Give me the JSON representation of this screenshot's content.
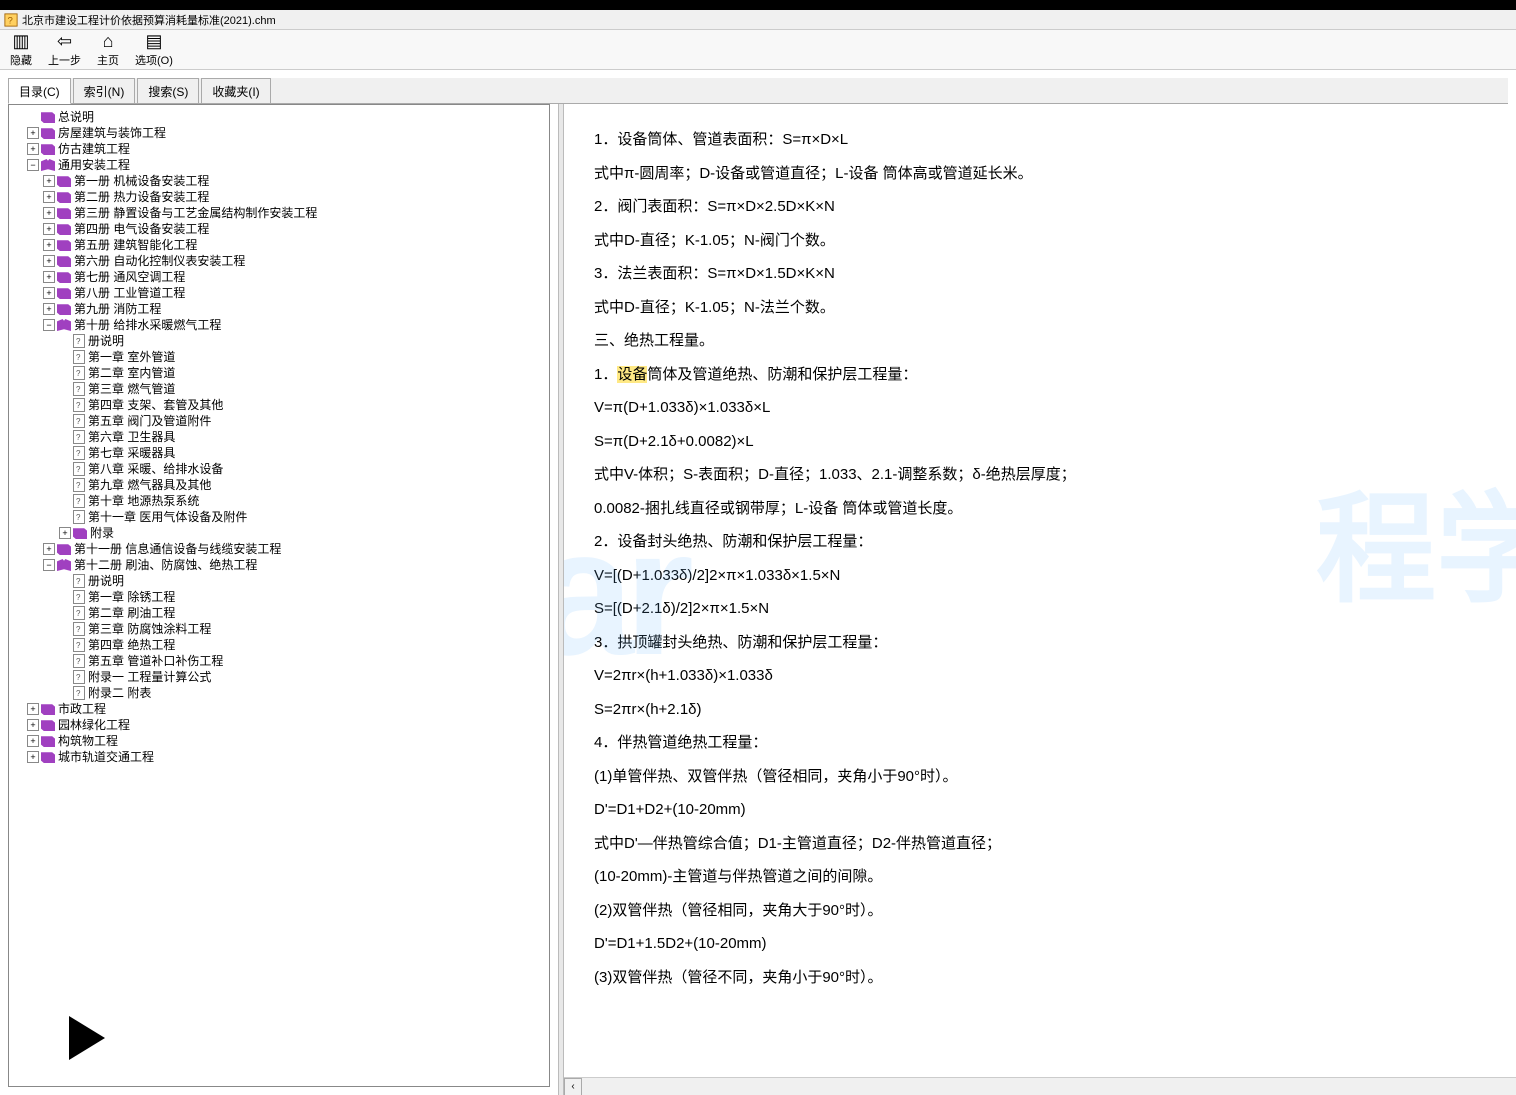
{
  "window": {
    "title": "北京市建设工程计价依据预算消耗量标准(2021).chm"
  },
  "toolbar": {
    "hide": "隐藏",
    "back": "上一步",
    "home": "主页",
    "options": "选项(O)"
  },
  "tabs": {
    "toc": "目录(C)",
    "index": "索引(N)",
    "search": "搜索(S)",
    "fav": "收藏夹(I)"
  },
  "tree": {
    "n0": "总说明",
    "n1": "房屋建筑与装饰工程",
    "n2": "仿古建筑工程",
    "n3": "通用安装工程",
    "n3_1": "第一册 机械设备安装工程",
    "n3_2": "第二册 热力设备安装工程",
    "n3_3": "第三册 静置设备与工艺金属结构制作安装工程",
    "n3_4": "第四册 电气设备安装工程",
    "n3_5": "第五册 建筑智能化工程",
    "n3_6": "第六册 自动化控制仪表安装工程",
    "n3_7": "第七册 通风空调工程",
    "n3_8": "第八册 工业管道工程",
    "n3_9": "第九册 消防工程",
    "n3_10": "第十册 给排水采暖燃气工程",
    "n3_10_0": "册说明",
    "n3_10_1": "第一章 室外管道",
    "n3_10_2": "第二章 室内管道",
    "n3_10_3": "第三章 燃气管道",
    "n3_10_4": "第四章 支架、套管及其他",
    "n3_10_5": "第五章 阀门及管道附件",
    "n3_10_6": "第六章 卫生器具",
    "n3_10_7": "第七章 采暖器具",
    "n3_10_8": "第八章 采暖、给排水设备",
    "n3_10_9": "第九章 燃气器具及其他",
    "n3_10_10": "第十章 地源热泵系统",
    "n3_10_11": "第十一章 医用气体设备及附件",
    "n3_10_a": "附录",
    "n3_11": "第十一册 信息通信设备与线缆安装工程",
    "n3_12": "第十二册 刷油、防腐蚀、绝热工程",
    "n3_12_0": "册说明",
    "n3_12_1": "第一章 除锈工程",
    "n3_12_2": "第二章 刷油工程",
    "n3_12_3": "第三章 防腐蚀涂料工程",
    "n3_12_4": "第四章 绝热工程",
    "n3_12_5": "第五章 管道补口补伤工程",
    "n3_12_a1": "附录一 工程量计算公式",
    "n3_12_a2": "附录二 附表",
    "n4": "市政工程",
    "n5": "园林绿化工程",
    "n6": "构筑物工程",
    "n7": "城市轨道交通工程"
  },
  "content": {
    "l1": "1．设备筒体、管道表面积：S=π×D×L",
    "l2": "式中π-圆周率；D-设备或管道直径；L-设备 筒体高或管道延长米。",
    "l3": "2．阀门表面积：S=π×D×2.5D×K×N",
    "l4": "式中D-直径；K-1.05；N-阀门个数。",
    "l5": "3．法兰表面积：S=π×D×1.5D×K×N",
    "l6": "式中D-直径；K-1.05；N-法兰个数。",
    "l7": "三、绝热工程量。",
    "l8a": "1．",
    "l8b": "设备",
    "l8c": "筒体及管道绝热、防潮和保护层工程量：",
    "l9": "V=π(D+1.033δ)×1.033δ×L",
    "l10": "S=π(D+2.1δ+0.0082)×L",
    "l11": "式中V-体积；S-表面积；D-直径；1.033、2.1-调整系数；δ-绝热层厚度；",
    "l12": "0.0082-捆扎线直径或钢带厚；L-设备 筒体或管道长度。",
    "l13": "2．设备封头绝热、防潮和保护层工程量：",
    "l14": "V=[(D+1.033δ)/2]2×π×1.033δ×1.5×N",
    "l15": "S=[(D+2.1δ)/2]2×π×1.5×N",
    "l16": "3．拱顶罐封头绝热、防潮和保护层工程量：",
    "l17": "V=2πr×(h+1.033δ)×1.033δ",
    "l18": "S=2πr×(h+2.1δ)",
    "l19": "4．伴热管道绝热工程量：",
    "l20": "(1)单管伴热、双管伴热（管径相同，夹角小于90°时）。",
    "l21": "D'=D1+D2+(10-20mm)",
    "l22": "式中D'—伴热管综合值；D1-主管道直径；D2-伴热管道直径；",
    "l23": "(10-20mm)-主管道与伴热管道之间的间隙。",
    "l24": "(2)双管伴热（管径相同，夹角大于90°时）。",
    "l25": "D'=D1+1.5D2+(10-20mm)",
    "l26": "(3)双管伴热（管径不同，夹角小于90°时）。"
  }
}
